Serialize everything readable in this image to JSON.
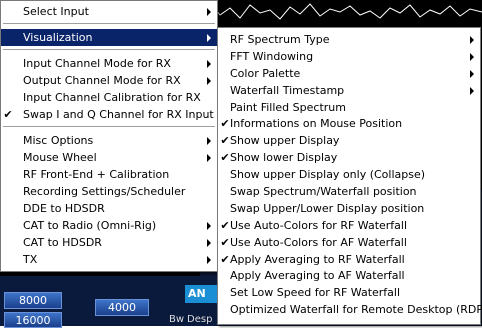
{
  "background": {
    "freq_buttons": [
      "8000",
      "16000",
      "4000"
    ],
    "cyan_button": "AN",
    "labels": [
      "Bw",
      "Desp"
    ]
  },
  "main_menu": {
    "groups": [
      [
        {
          "label": "Select Input",
          "submenu": true
        }
      ],
      [
        {
          "label": "Visualization",
          "submenu": true,
          "selected": true
        }
      ],
      [
        {
          "label": "Input Channel Mode for RX",
          "submenu": true
        },
        {
          "label": "Output Channel Mode for RX",
          "submenu": true
        },
        {
          "label": "Input Channel Calibration for RX",
          "submenu": false
        },
        {
          "label": "Swap I and Q Channel for RX Input",
          "submenu": false,
          "checked": true
        }
      ],
      [
        {
          "label": "Misc Options",
          "submenu": true
        },
        {
          "label": "Mouse Wheel",
          "submenu": true
        },
        {
          "label": "RF Front-End + Calibration",
          "submenu": false
        },
        {
          "label": "Recording Settings/Scheduler",
          "submenu": false
        },
        {
          "label": "DDE to HDSDR",
          "submenu": false
        },
        {
          "label": "CAT to Radio (Omni-Rig)",
          "submenu": true
        },
        {
          "label": "CAT to HDSDR",
          "submenu": true
        },
        {
          "label": "TX",
          "submenu": true
        }
      ]
    ]
  },
  "visualization_menu": {
    "items": [
      {
        "label": "RF Spectrum Type",
        "submenu": true
      },
      {
        "label": "FFT Windowing",
        "submenu": true
      },
      {
        "label": "Color Palette",
        "submenu": true
      },
      {
        "label": "Waterfall Timestamp",
        "submenu": true
      },
      {
        "label": "Paint Filled Spectrum"
      },
      {
        "label": "Informations on Mouse Position",
        "checked": true
      },
      {
        "label": "Show upper Display",
        "checked": true
      },
      {
        "label": "Show lower Display",
        "checked": true
      },
      {
        "label": "Show upper Display only (Collapse)"
      },
      {
        "label": "Swap Spectrum/Waterfall position"
      },
      {
        "label": "Swap Upper/Lower Display position"
      },
      {
        "label": "Use Auto-Colors for RF Waterfall",
        "checked": true
      },
      {
        "label": "Use Auto-Colors for AF Waterfall",
        "checked": true
      },
      {
        "label": "Apply Averaging to RF Waterfall",
        "checked": true
      },
      {
        "label": "Apply Averaging to AF Waterfall"
      },
      {
        "label": "Set Low Speed for RF Waterfall"
      },
      {
        "label": "Optimized Waterfall for Remote Desktop (RDP)"
      }
    ]
  },
  "check_glyph": "✔"
}
